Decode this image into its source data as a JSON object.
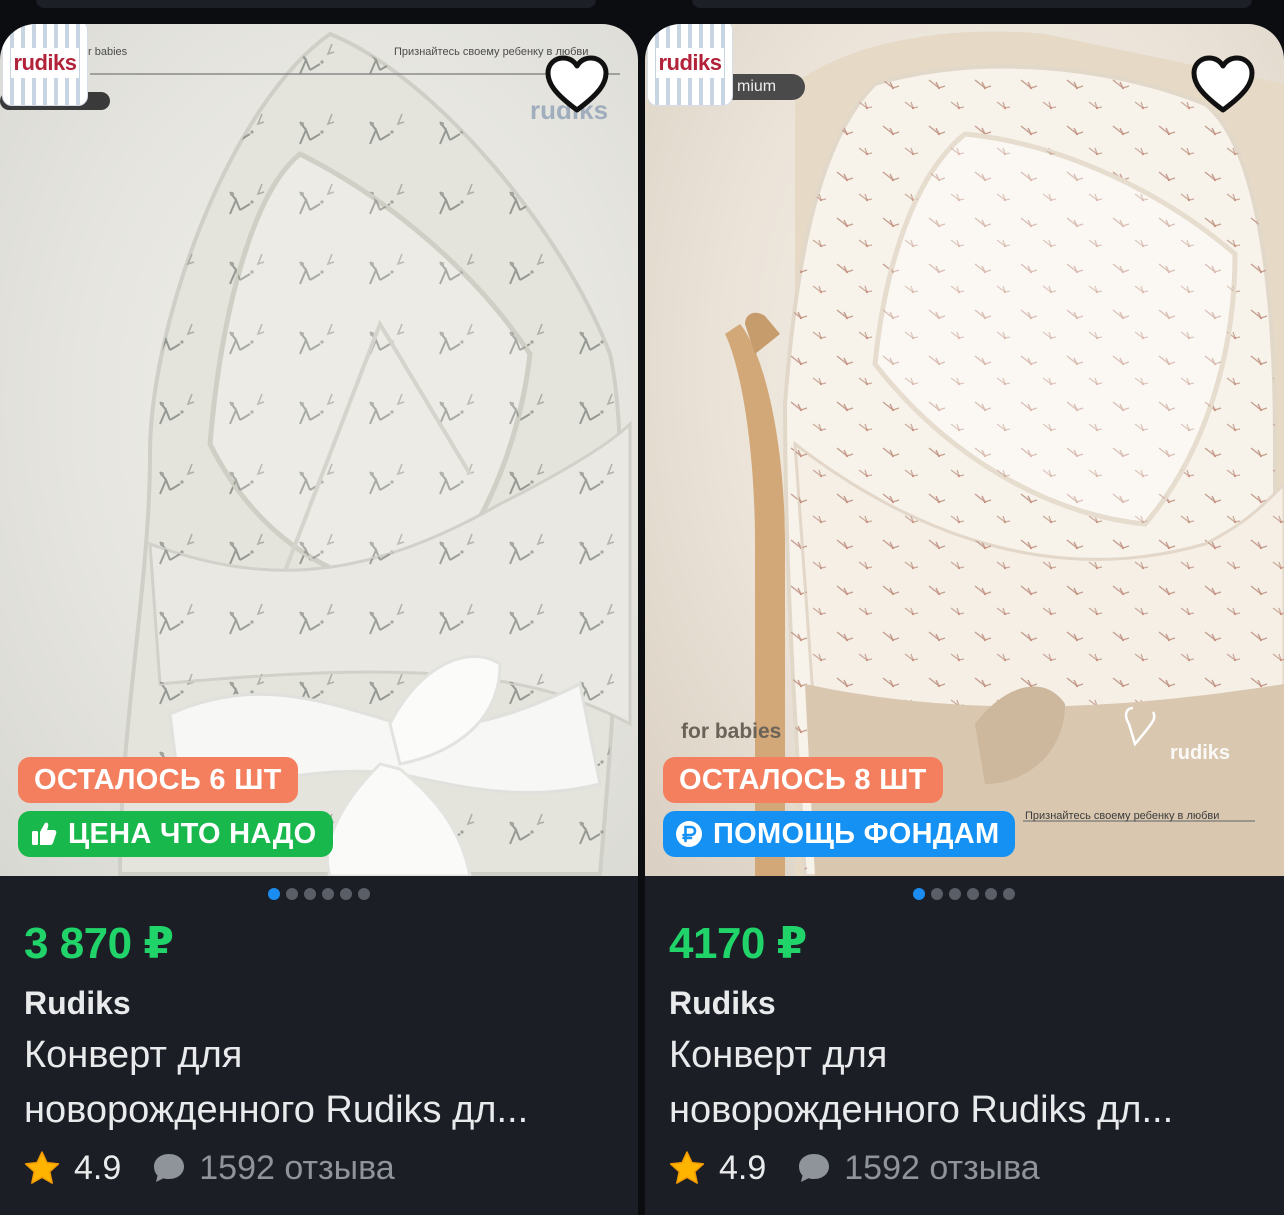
{
  "products": [
    {
      "brand_logo": "rudiks",
      "photo_text_top_left": "r babies",
      "photo_text_top_right": "Признайтесь своему ребенку в любви",
      "photo_watermark": "rudiks",
      "favorite_icon": "heart-outline-icon",
      "stock_badge": "ОСТАЛОСЬ 6 ШТ",
      "promo_badge": "ЦЕНА ЧТО НАДО",
      "promo_icon": "thumbs-up-icon",
      "promo_color": "#19b84d",
      "price": "3 870 ₽",
      "seller": "Rudiks",
      "title_line1": "Конверт для",
      "title_line2": "новорожденного Rudiks дл...",
      "rating": "4.9",
      "reviews": "1592 отзыва",
      "carousel": {
        "total": 6,
        "active": 1
      }
    },
    {
      "brand_logo": "rudiks",
      "photo_text_top_left": "mium",
      "photo_text_bottom_left": "for babies",
      "photo_text_bottom_right": "Признайтесь своему ребенку в любви",
      "photo_watermark": "rudiks",
      "favorite_icon": "heart-outline-icon",
      "stock_badge": "ОСТАЛОСЬ 8 ШТ",
      "promo_badge": "ПОМОЩЬ ФОНДАМ",
      "promo_icon": "ruble-coin-icon",
      "promo_color": "#1491f2",
      "price": "4170 ₽",
      "seller": "Rudiks",
      "title_line1": "Конверт для",
      "title_line2": "новорожденного Rudiks дл...",
      "rating": "4.9",
      "reviews": "1592 отзыва",
      "carousel": {
        "total": 6,
        "active": 1
      }
    }
  ],
  "colors": {
    "price": "#21d46a",
    "stock_badge": "#f47f5f",
    "card_bg": "#1b1e25",
    "page_bg": "#0b0d10",
    "dot_active": "#1b8cf0"
  }
}
